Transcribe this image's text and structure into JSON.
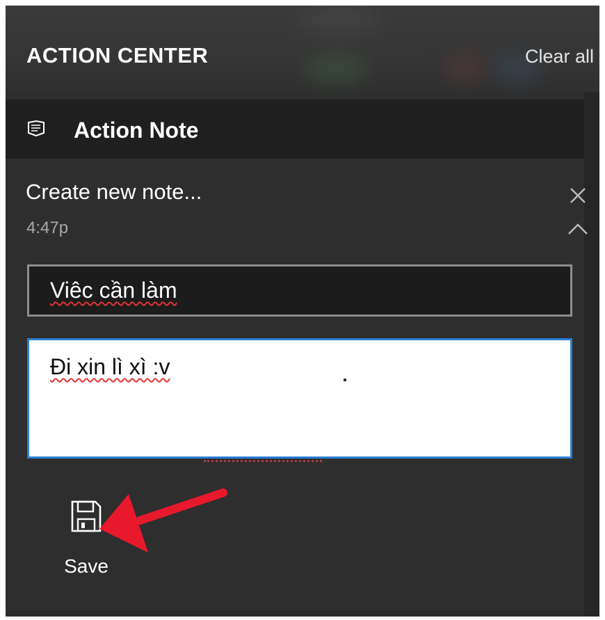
{
  "header": {
    "title": "ACTION CENTER",
    "clear_all_label": "Clear all"
  },
  "app": {
    "name": "Action Note",
    "icon": "action-note-icon"
  },
  "notification": {
    "title": "Create new note...",
    "time": "4:47p",
    "close_icon": "close-icon",
    "collapse_icon": "chevron-up-icon"
  },
  "form": {
    "title_value": "Viêc cần làm",
    "body_value": "Đi xin lì xì :v"
  },
  "actions": {
    "save_label": "Save",
    "save_icon": "floppy-disk-icon"
  },
  "colors": {
    "background": "#2e2e2e",
    "app_bar": "#1f1f1f",
    "input_focus_border": "#2a7fd4",
    "annotation_arrow": "#e8192c",
    "spellcheck_underline": "#e23434"
  }
}
